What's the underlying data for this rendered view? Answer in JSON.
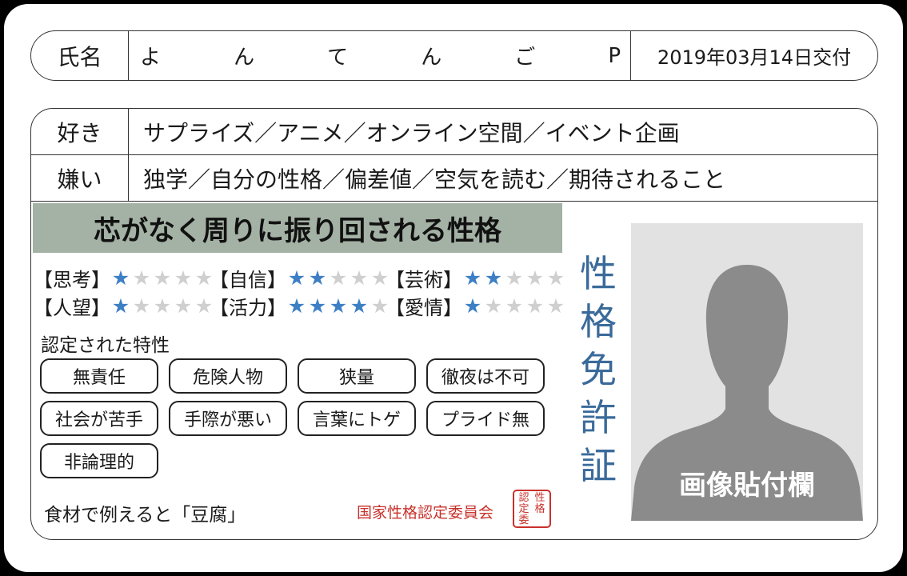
{
  "name_row": {
    "label": "氏名",
    "name_chars": [
      "よ",
      "ん",
      "て",
      "ん",
      "ご",
      "P"
    ],
    "issued": "2019年03月14日交付"
  },
  "likes": {
    "label": "好き",
    "value": "サプライズ／アニメ／オンライン空間／イベント企画"
  },
  "dislikes": {
    "label": "嫌い",
    "value": "独学／自分の性格／偏差値／空気を読む／期待されること"
  },
  "headline": "芯がなく周りに振り回される性格",
  "stats": [
    {
      "label": "【思考】",
      "level": 1,
      "max": 5
    },
    {
      "label": "【自信】",
      "level": 2,
      "max": 5
    },
    {
      "label": "【芸術】",
      "level": 2,
      "max": 5
    },
    {
      "label": "【人望】",
      "level": 1,
      "max": 5
    },
    {
      "label": "【活力】",
      "level": 4,
      "max": 5
    },
    {
      "label": "【愛情】",
      "level": 1,
      "max": 5
    }
  ],
  "star_color_on": "#3d7fc4",
  "star_color_off": "#cfcfcf",
  "traits_title": "認定された特性",
  "traits": [
    "無責任",
    "危険人物",
    "狭量",
    "徹夜は不可",
    "社会が苦手",
    "手際が悪い",
    "言葉にトゲ",
    "プライド無",
    "非論理的"
  ],
  "food": "食材で例えると「豆腐」",
  "committee": "国家性格認定委員会",
  "seal_chars": [
    "認",
    "性",
    "定",
    "格",
    "委",
    ""
  ],
  "vertical_title": [
    "性",
    "格",
    "免",
    "許",
    "証"
  ],
  "photo_label": "画像貼付欄"
}
